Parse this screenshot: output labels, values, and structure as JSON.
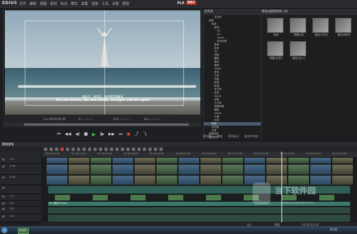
{
  "app": {
    "logo": "EDIUS",
    "menus": [
      "文件",
      "编辑",
      "视图",
      "素材",
      "标记",
      "模式",
      "采集",
      "渲染",
      "工具",
      "设置",
      "帮助"
    ],
    "pl_label": "PLR",
    "rec_label": "REC"
  },
  "preview": {
    "subtitle_cn": "海仙子，海女巫，海中橙色的精灵",
    "subtitle_en": "The sea fairies, the sea fairies, Oranges and the spirit",
    "timecodes": [
      "Cur 00:00:02;06",
      "In --:--:--;--",
      "Out --:--:--;--",
      "Dur --:--:--;--"
    ]
  },
  "transport": [
    "⏮",
    "◀◀",
    "◀|",
    "■",
    "▶",
    "|▶",
    "▶▶",
    "⏭",
    "●",
    "⤴",
    "⤵"
  ],
  "tree": {
    "header": "文件夹",
    "items": [
      "文件夹",
      "视频",
      "转场",
      "转场",
      "2D",
      "3D",
      "Alpha",
      "单页效果",
      "旋转",
      "运动",
      "3D",
      "扭转",
      "翻转",
      "滑动",
      "翻页",
      "Alpha",
      "卷页",
      "立体",
      "扭曲",
      "转场",
      "轨道",
      "多方体",
      "双层",
      "Alpha",
      "滤镜",
      "立方体",
      "视频效果",
      "翻转",
      "Alpha",
      "分离",
      "闪白",
      "闪白",
      "对比度",
      "合成",
      "视频转场",
      "音频转场"
    ],
    "selected_index": 31,
    "selected_label": "视频转场"
  },
  "fx": {
    "header": "特效(视频转场)-2D",
    "items": [
      "溶化",
      "划像(边)",
      "推拉(方向)",
      "推拉(单向)",
      "划像(方形)",
      "溶化(淡入)"
    ]
  },
  "panel_tabs": [
    "素材库",
    "特效",
    "序列标记",
    "源文件浏览"
  ],
  "timeline": {
    "title": "EDIUS",
    "ruler": [
      "00:00:00;00",
      "00:00:10;00",
      "00:00:20;00",
      "00:00:30;00",
      "00:00:40;00",
      "00:00:50;00",
      "00:01:00;00",
      "00:01:10;00",
      "00:01:20;00",
      "00:01:30;00",
      "00:01:40;00",
      "00:01:50;00"
    ],
    "tracks": [
      {
        "name": "1 V",
        "clip": "",
        "type": "video"
      },
      {
        "name": "1 VA",
        "clip": "",
        "type": "video"
      },
      {
        "name": "2 VA",
        "clip": "",
        "type": "video"
      },
      {
        "name": "",
        "clip": "",
        "type": "audio"
      },
      {
        "name": "1 T",
        "clip": "",
        "type": "title"
      },
      {
        "name": "2 A",
        "clip": "01.海仙子.mp3",
        "type": "audio"
      },
      {
        "name": "3 A",
        "clip": "",
        "type": "audio"
      },
      {
        "name": "4 A",
        "clip": "",
        "type": "audio"
      }
    ],
    "status": [
      "插入",
      "覆盖",
      "00:00:03;04"
    ]
  },
  "taskbar": {
    "app": "EDIUS",
    "time": "16:05"
  },
  "watermark": {
    "line1": "当下软件园",
    "line2": "www.downxia.com"
  }
}
